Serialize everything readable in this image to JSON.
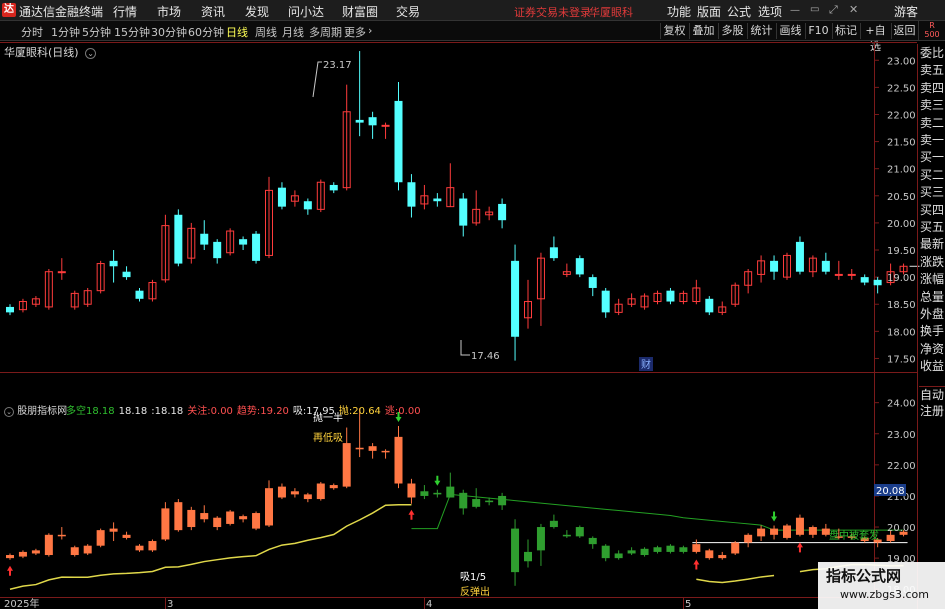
{
  "menu": {
    "app_name": "通达信金融终端",
    "items": [
      "行情",
      "市场",
      "资讯",
      "发现",
      "问小达",
      "财富圈",
      "交易"
    ],
    "account_warning": "证券交易未登录",
    "stock_short": "华厦眼科",
    "right_items": [
      "功能",
      "版面",
      "公式",
      "选项"
    ],
    "guest": "游客"
  },
  "periods": {
    "items": [
      "分时",
      "1分钟",
      "5分钟",
      "15分钟",
      "30分钟",
      "60分钟",
      "日线",
      "周线",
      "月线",
      "多周期",
      "更多"
    ],
    "active": "日线"
  },
  "toolbar": [
    "复权",
    "叠加",
    "多股",
    "统计",
    "画线",
    "F10",
    "标记",
    "+自选",
    "返回"
  ],
  "r500": {
    "top": "R",
    "bottom": "500"
  },
  "stock_title": "华厦眼科(日线)",
  "right_panel": {
    "group1": [
      "委比",
      "卖五",
      "卖四",
      "卖三",
      "卖二",
      "卖一",
      "买一",
      "买二",
      "买三",
      "买四",
      "买五",
      "最新",
      "涨跌",
      "涨幅",
      "总量",
      "外盘",
      "换手",
      "净资",
      "收益"
    ],
    "group2": [
      "自动",
      "注册"
    ]
  },
  "price_axis": {
    "labels": [
      "23.00",
      "22.50",
      "22.00",
      "21.50",
      "21.00",
      "20.50",
      "20.00",
      "19.50",
      "19.00",
      "18.50",
      "18.00",
      "17.50"
    ],
    "high_label": "23.17",
    "low_label": "17.46",
    "event_marker": "财"
  },
  "indicator": {
    "name": "股朋指标网",
    "items": [
      {
        "label": "多空",
        "value": "18.18",
        "color": "#2fbf2f"
      },
      {
        "label": "",
        "value": "18.18",
        "color": "#e8e8e8"
      },
      {
        "label": "",
        "value": ":18.18",
        "color": "#e8e8e8"
      },
      {
        "label": "关注:",
        "value": "0.00",
        "color": "#ff5050"
      },
      {
        "label": "趋势:",
        "value": "19.20",
        "color": "#ff5050"
      },
      {
        "label": "吸:",
        "value": "17.95",
        "color": "#e8e8e8"
      },
      {
        "label": "抛:",
        "value": "20.64",
        "color": "#ffd23c"
      },
      {
        "label": "逃:",
        "value": "0.00",
        "color": "#ff5050"
      }
    ],
    "axis_labels": [
      "24.00",
      "23.00",
      "22.00",
      "21.00",
      "20.00",
      "19.00",
      "18.00"
    ],
    "current_tag": "20.08",
    "annotations": {
      "top1": "抛一半",
      "top2": "再低吸",
      "bottom1": "吸1/5",
      "bottom2": "反弹出",
      "right": "盘中被套发"
    }
  },
  "date_axis": [
    "2025年",
    "3",
    "4",
    "5"
  ],
  "watermark": {
    "line1": "指标公式网",
    "line2": "www.zbgs3.com"
  },
  "chart_data": [
    {
      "type": "candlestick",
      "title": "华厦眼科(日线)",
      "ylim": [
        17.25,
        23.3
      ],
      "candles": [
        {
          "o": 18.45,
          "c": 18.35,
          "h": 18.5,
          "l": 18.3
        },
        {
          "o": 18.4,
          "c": 18.55,
          "h": 18.6,
          "l": 18.35
        },
        {
          "o": 18.5,
          "c": 18.6,
          "h": 18.65,
          "l": 18.45
        },
        {
          "o": 18.45,
          "c": 19.1,
          "h": 19.15,
          "l": 18.4
        },
        {
          "o": 19.1,
          "c": 19.1,
          "h": 19.35,
          "l": 18.95
        },
        {
          "o": 18.45,
          "c": 18.7,
          "h": 18.75,
          "l": 18.4
        },
        {
          "o": 18.5,
          "c": 18.75,
          "h": 18.8,
          "l": 18.45
        },
        {
          "o": 18.75,
          "c": 19.25,
          "h": 19.3,
          "l": 18.7
        },
        {
          "o": 19.3,
          "c": 19.2,
          "h": 19.5,
          "l": 18.9
        },
        {
          "o": 19.1,
          "c": 19.0,
          "h": 19.2,
          "l": 18.95
        },
        {
          "o": 18.75,
          "c": 18.6,
          "h": 18.8,
          "l": 18.55
        },
        {
          "o": 18.6,
          "c": 18.9,
          "h": 18.95,
          "l": 18.55
        },
        {
          "o": 18.95,
          "c": 19.95,
          "h": 20.15,
          "l": 18.9
        },
        {
          "o": 20.15,
          "c": 19.25,
          "h": 20.25,
          "l": 19.2
        },
        {
          "o": 19.35,
          "c": 19.9,
          "h": 20.0,
          "l": 19.25
        },
        {
          "o": 19.8,
          "c": 19.6,
          "h": 20.05,
          "l": 19.5
        },
        {
          "o": 19.65,
          "c": 19.35,
          "h": 19.7,
          "l": 19.25
        },
        {
          "o": 19.45,
          "c": 19.85,
          "h": 19.9,
          "l": 19.4
        },
        {
          "o": 19.7,
          "c": 19.6,
          "h": 19.75,
          "l": 19.5
        },
        {
          "o": 19.8,
          "c": 19.3,
          "h": 19.85,
          "l": 19.25
        },
        {
          "o": 19.4,
          "c": 20.6,
          "h": 20.85,
          "l": 19.35
        },
        {
          "o": 20.65,
          "c": 20.3,
          "h": 20.75,
          "l": 20.25
        },
        {
          "o": 20.4,
          "c": 20.5,
          "h": 20.6,
          "l": 20.3
        },
        {
          "o": 20.4,
          "c": 20.25,
          "h": 20.45,
          "l": 20.15
        },
        {
          "o": 20.25,
          "c": 20.75,
          "h": 20.8,
          "l": 20.2
        },
        {
          "o": 20.7,
          "c": 20.6,
          "h": 20.75,
          "l": 20.55
        },
        {
          "o": 20.65,
          "c": 22.05,
          "h": 22.55,
          "l": 20.6
        },
        {
          "o": 21.9,
          "c": 21.85,
          "h": 23.17,
          "l": 21.6
        },
        {
          "o": 21.95,
          "c": 21.8,
          "h": 22.05,
          "l": 21.55
        },
        {
          "o": 21.8,
          "c": 21.8,
          "h": 21.85,
          "l": 21.55
        },
        {
          "o": 22.25,
          "c": 20.75,
          "h": 22.6,
          "l": 20.6
        },
        {
          "o": 20.75,
          "c": 20.3,
          "h": 20.9,
          "l": 20.1
        },
        {
          "o": 20.35,
          "c": 20.5,
          "h": 20.7,
          "l": 20.25
        },
        {
          "o": 20.45,
          "c": 20.4,
          "h": 20.55,
          "l": 20.3
        },
        {
          "o": 20.3,
          "c": 20.65,
          "h": 21.1,
          "l": 20.3
        },
        {
          "o": 20.45,
          "c": 19.95,
          "h": 20.55,
          "l": 19.75
        },
        {
          "o": 20.0,
          "c": 20.25,
          "h": 20.6,
          "l": 19.95
        },
        {
          "o": 20.15,
          "c": 20.2,
          "h": 20.3,
          "l": 20.05
        },
        {
          "o": 20.35,
          "c": 20.05,
          "h": 20.45,
          "l": 19.9
        },
        {
          "o": 19.3,
          "c": 17.9,
          "h": 19.6,
          "l": 17.46
        },
        {
          "o": 18.25,
          "c": 18.55,
          "h": 18.95,
          "l": 18.05
        },
        {
          "o": 18.6,
          "c": 19.35,
          "h": 19.45,
          "l": 18.1
        },
        {
          "o": 19.55,
          "c": 19.35,
          "h": 19.75,
          "l": 19.3
        },
        {
          "o": 19.05,
          "c": 19.1,
          "h": 19.25,
          "l": 19.0
        },
        {
          "o": 19.35,
          "c": 19.05,
          "h": 19.4,
          "l": 19.0
        },
        {
          "o": 19.0,
          "c": 18.8,
          "h": 19.05,
          "l": 18.65
        },
        {
          "o": 18.75,
          "c": 18.35,
          "h": 18.8,
          "l": 18.25
        },
        {
          "o": 18.35,
          "c": 18.5,
          "h": 18.6,
          "l": 18.3
        },
        {
          "o": 18.5,
          "c": 18.6,
          "h": 18.7,
          "l": 18.45
        },
        {
          "o": 18.45,
          "c": 18.65,
          "h": 18.7,
          "l": 18.4
        },
        {
          "o": 18.55,
          "c": 18.7,
          "h": 18.75,
          "l": 18.5
        },
        {
          "o": 18.75,
          "c": 18.55,
          "h": 18.8,
          "l": 18.5
        },
        {
          "o": 18.55,
          "c": 18.7,
          "h": 18.75,
          "l": 18.5
        },
        {
          "o": 18.55,
          "c": 18.8,
          "h": 18.95,
          "l": 18.5
        },
        {
          "o": 18.6,
          "c": 18.35,
          "h": 18.65,
          "l": 18.3
        },
        {
          "o": 18.35,
          "c": 18.45,
          "h": 18.55,
          "l": 18.3
        },
        {
          "o": 18.5,
          "c": 18.85,
          "h": 18.9,
          "l": 18.45
        },
        {
          "o": 18.85,
          "c": 19.1,
          "h": 19.15,
          "l": 18.7
        },
        {
          "o": 19.05,
          "c": 19.3,
          "h": 19.4,
          "l": 18.9
        },
        {
          "o": 19.3,
          "c": 19.1,
          "h": 19.4,
          "l": 18.95
        },
        {
          "o": 19.0,
          "c": 19.4,
          "h": 19.45,
          "l": 18.95
        },
        {
          "o": 19.65,
          "c": 19.1,
          "h": 19.75,
          "l": 19.05
        },
        {
          "o": 19.1,
          "c": 19.35,
          "h": 19.4,
          "l": 19.0
        },
        {
          "o": 19.3,
          "c": 19.1,
          "h": 19.45,
          "l": 19.05
        },
        {
          "o": 19.05,
          "c": 19.05,
          "h": 19.3,
          "l": 18.95
        },
        {
          "o": 19.05,
          "c": 19.05,
          "h": 19.15,
          "l": 18.95
        },
        {
          "o": 19.0,
          "c": 18.9,
          "h": 19.05,
          "l": 18.85
        },
        {
          "o": 18.95,
          "c": 18.85,
          "h": 19.0,
          "l": 18.7
        },
        {
          "o": 18.9,
          "c": 19.1,
          "h": 19.25,
          "l": 18.85
        },
        {
          "o": 19.1,
          "c": 19.2,
          "h": 19.25,
          "l": 19.05
        }
      ]
    },
    {
      "type": "candlestick",
      "title": "股朋指标网",
      "ylim": [
        17.75,
        24.15
      ],
      "series": [
        {
          "name": "趋势",
          "color": "#e0d84a"
        },
        {
          "name": "抛",
          "color": "#23a023"
        },
        {
          "name": "吸",
          "color": "#ffffff"
        }
      ]
    }
  ]
}
